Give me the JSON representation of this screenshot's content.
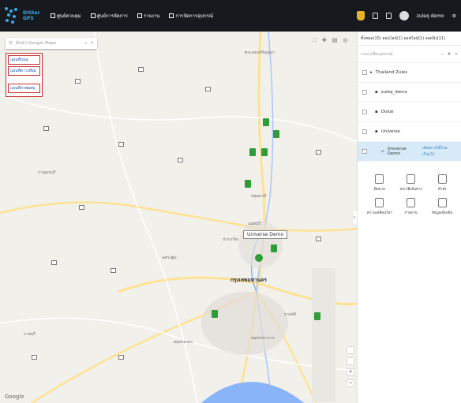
{
  "topbar": {
    "logo_line1": "DIStar",
    "logo_line2": "GPS",
    "nav": [
      {
        "label": "ศูนย์ควบคุม",
        "icon": "square-icon"
      },
      {
        "label": "ศูนย์การจัดการ",
        "icon": "grid-icon"
      },
      {
        "label": "รายงาน",
        "icon": "chart-icon"
      },
      {
        "label": "การจัดการอุปกรณ์",
        "icon": "device-icon"
      }
    ],
    "username": "zuleq demo"
  },
  "map": {
    "search_placeholder": "ค้นหา Google Maps",
    "layer_menu": [
      "แผนที่ถนน",
      "แผนที่ดาวเทียม",
      "แผนที่ภาพผสม"
    ],
    "popup_label": "Universe Demo",
    "city_label": "กรุงเทพมหานคร",
    "attribution": "Google",
    "place_labels": [
      "พระนครศรีอยุธยา",
      "กาญจนบุรี",
      "นครปฐม",
      "ปทุมธานี",
      "นนทบุรี",
      "สมุทรปราการ",
      "ปากเกร็ด",
      "สมุทรสาคร",
      "ราชบุรี",
      "บางพลี"
    ]
  },
  "panel": {
    "tabs": "ทั้งหมด(15)  ออนไลน์(1)  ออฟไลน์(1)  จอดนิ่ง(11)",
    "search_placeholder": "กรุณาเลือกอุปกรณ์",
    "tree": [
      {
        "label": "Thailand Zules",
        "level": 0
      },
      {
        "label": "zuleq_demo",
        "level": 1
      },
      {
        "label": "Distar",
        "level": 1
      },
      {
        "label": "Universe",
        "level": 1
      },
      {
        "label": "Universe Demo",
        "level": 2,
        "status": "เดินทางได้ไกลเกิน(1)"
      }
    ],
    "device_actions": [
      "ติดตาม",
      "ประวัติเส้นทาง",
      "คำสั่ง",
      "ความเคลื่อนไหว",
      "ภาพถ่าย",
      "ข้อมูลเพิ่มเติม"
    ]
  },
  "colors": {
    "topbar": "#161a1e",
    "accent": "#3aa8ea",
    "marker": "#2f9c39",
    "selected_row": "#d6ebf7",
    "menu_border": "#c93030"
  }
}
